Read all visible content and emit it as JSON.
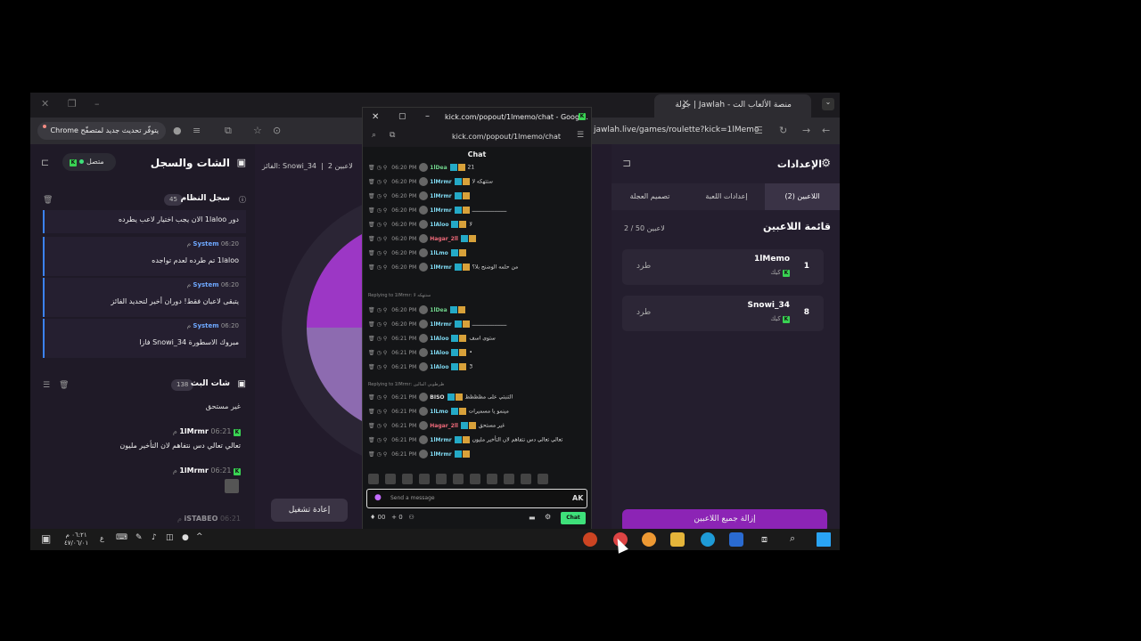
{
  "browser": {
    "tab_title": "جولة | Jawlah - منصة الألعاب الت",
    "update_label": "يتوفّر تحديث جديد لمتصفّح Chrome",
    "url": "jawlah.live/games/roulette?kick=1lMemo"
  },
  "left_panel": {
    "title": "الشات والسجل",
    "connection": "متصل",
    "system_log": {
      "title": "سجل النظام",
      "count": "45",
      "items": [
        {
          "author": "",
          "time": "",
          "text": "دور 1laloo الان يجب اختيار لاعب يطرده"
        },
        {
          "author": "System",
          "time": "06:20 م",
          "text": "1laloo تم طرده لعدم تواجده"
        },
        {
          "author": "System",
          "time": "06:20 م",
          "text": "يتبقى لاعبان فقط! دوران أخير لتحديد الفائز"
        },
        {
          "author": "System",
          "time": "06:20 م",
          "text": "مبروك الاسطورة Snowi_34 فازا"
        }
      ]
    },
    "live_chat": {
      "title": "شات البث",
      "count": "138",
      "messages": [
        {
          "user": "",
          "time": "",
          "text": "غير مستحق"
        },
        {
          "user": "1lMrmr",
          "time": "06:21 م",
          "text": "تعالي تعالي دس نتفاهم لان التأخير مليون"
        },
        {
          "user": "1lMrmr",
          "time": "06:21 م",
          "text": ""
        },
        {
          "user": "iSTABEO",
          "time": "06:21 م",
          "text": ""
        }
      ]
    }
  },
  "middle": {
    "header_players": "2 لاعبين",
    "header_winner": "الفائز: Snowi_34",
    "replay_button": "إعادة تشغيل"
  },
  "right_panel": {
    "title": "الإعدادات",
    "tabs": [
      "اللاعبين (2)",
      "إعدادات اللعبة",
      "تصميم العجلة"
    ],
    "players_title": "قائمة اللاعبين",
    "players_count": "2 / 50 لاعبين",
    "kick_label": "طرد",
    "platform_label": "كيك",
    "players": [
      {
        "num": "1",
        "name": "1lMemo"
      },
      {
        "num": "8",
        "name": "Snowi_34"
      }
    ],
    "remove_all": "إزالة جميع اللاعبين"
  },
  "popup": {
    "window_title": "kick.com/popout/1lmemo/chat - Googl...",
    "url": "kick.com/popout/1lmemo/chat",
    "chat_label": "Chat",
    "input_placeholder": "Send a message",
    "chat_button": "Chat",
    "bottom_count": "00",
    "bottom_zero": "0",
    "messages": [
      {
        "time": "06:20 PM",
        "user": "1lDea",
        "color": "#6fd28a",
        "text": "21"
      },
      {
        "time": "06:20 PM",
        "user": "1lMrmr",
        "color": "#7fd8f0",
        "text": "ستتهكه لا"
      },
      {
        "time": "06:20 PM",
        "user": "1lMrmr",
        "color": "#7fd8f0",
        "text": ""
      },
      {
        "time": "06:20 PM",
        "user": "1lMrmr",
        "color": "#7fd8f0",
        "text": "ــــــــــــــــــــــ"
      },
      {
        "time": "06:20 PM",
        "user": "1lAloo",
        "color": "#7fd8f0",
        "text": "لا"
      },
      {
        "time": "06:20 PM",
        "user": "Hagar_2ll",
        "color": "#f06a7a",
        "text": ""
      },
      {
        "time": "06:20 PM",
        "user": "1lLmo",
        "color": "#7fd8f0",
        "text": ""
      },
      {
        "time": "06:20 PM",
        "user": "1lMrmr",
        "color": "#7fd8f0",
        "text": "من حلمه الوضنح بلا؟"
      },
      {
        "time": "06:20 PM",
        "user": "1lDea",
        "color": "#6fd28a",
        "text": ""
      },
      {
        "time": "06:20 PM",
        "user": "1lMrmr",
        "color": "#7fd8f0",
        "text": "ــــــــــــــــــــــ"
      },
      {
        "time": "06:21 PM",
        "user": "1lAloo",
        "color": "#7fd8f0",
        "text": "ستوى اسف"
      },
      {
        "time": "06:21 PM",
        "user": "1lAloo",
        "color": "#7fd8f0",
        "text": "•"
      },
      {
        "time": "06:21 PM",
        "user": "1lAloo",
        "color": "#7fd8f0",
        "text": "3"
      },
      {
        "time": "06:21 PM",
        "user": "BISO",
        "color": "#dddddd",
        "text": "التنبتي على مظظظظ"
      },
      {
        "time": "06:21 PM",
        "user": "1lLmo",
        "color": "#7fd8f0",
        "text": "مينمو يا مسميرات"
      },
      {
        "time": "06:21 PM",
        "user": "Hagar_2ll",
        "color": "#f06a7a",
        "text": "غير مستحق"
      },
      {
        "time": "06:21 PM",
        "user": "1lMrmr",
        "color": "#7fd8f0",
        "text": "تعالي تعالي دس نتفاهم لان التأخير مليون"
      },
      {
        "time": "06:21 PM",
        "user": "1lMrmr",
        "color": "#7fd8f0",
        "text": ""
      }
    ],
    "reply_1": "Replying to 1lMrmr: ستتهكه لا",
    "reply_2": "Replying to 1lMrmr: ظرطوبي المالين"
  },
  "taskbar": {
    "time": "٠٦:٢١ م",
    "date": "٤٧/٠٦/٠١",
    "lang": "ع"
  },
  "colors": {
    "accent": "#8c24b5",
    "kick_green": "#3ee07a",
    "system_blue": "#6ea8ff"
  }
}
